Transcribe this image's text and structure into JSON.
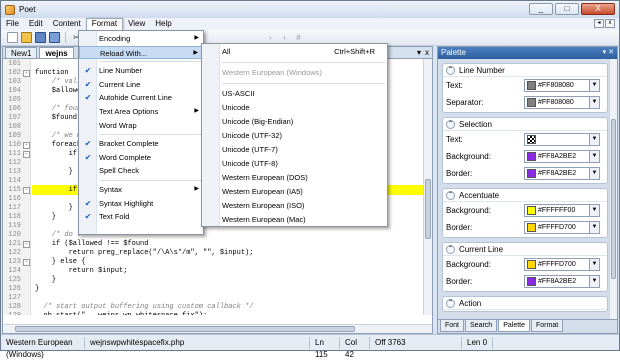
{
  "window": {
    "title": "Poet",
    "minimize_label": "_",
    "maximize_label": "□",
    "close_label": "X"
  },
  "menubar": {
    "items": [
      "File",
      "Edit",
      "Content",
      "Format",
      "View",
      "Help"
    ],
    "mdi_prev_label": "◂",
    "mdi_close_label": "x"
  },
  "editor": {
    "tabs": [
      "New1",
      "wejns"
    ],
    "tab_close_label": "x",
    "tab_menu_label": "▾",
    "lines": [
      {
        "n": "101",
        "fold": "",
        "text": ""
      },
      {
        "n": "102",
        "fold": "-",
        "text": "function "
      },
      {
        "n": "103",
        "fold": "",
        "text": "    /* vali"
      },
      {
        "n": "104",
        "fold": "",
        "text": "    $allowe"
      },
      {
        "n": "105",
        "fold": "",
        "text": ""
      },
      {
        "n": "106",
        "fold": "",
        "text": "    /* foun"
      },
      {
        "n": "107",
        "fold": "",
        "text": "    $found "
      },
      {
        "n": "108",
        "fold": "",
        "text": ""
      },
      {
        "n": "109",
        "fold": "",
        "text": "    /* we m"
      },
      {
        "n": "110",
        "fold": "-",
        "text": "    foreach"
      },
      {
        "n": "111",
        "fold": "-",
        "text": "        if "
      },
      {
        "n": "112",
        "fold": "",
        "text": "            "
      },
      {
        "n": "113",
        "fold": "",
        "text": "        }"
      },
      {
        "n": "114",
        "fold": "",
        "text": ""
      },
      {
        "n": "115",
        "fold": "-",
        "text": "        if "
      },
      {
        "n": "116",
        "fold": "",
        "text": ""
      },
      {
        "n": "117",
        "fold": "",
        "text": "        }"
      },
      {
        "n": "118",
        "fold": "",
        "text": "    }"
      },
      {
        "n": "119",
        "fold": "",
        "text": ""
      },
      {
        "n": "120",
        "fold": "",
        "text": "    /* do t"
      },
      {
        "n": "121",
        "fold": "-",
        "text": "    if ($allowed !== $found"
      },
      {
        "n": "122",
        "fold": "",
        "text": "        return preg_replace(\"/\\A\\s*/m\", \"\", $input);"
      },
      {
        "n": "123",
        "fold": "-",
        "text": "    } else {"
      },
      {
        "n": "124",
        "fold": "",
        "text": "        return $input;"
      },
      {
        "n": "125",
        "fold": "",
        "text": "    }"
      },
      {
        "n": "126",
        "fold": "",
        "text": "}"
      },
      {
        "n": "127",
        "fold": "",
        "text": ""
      },
      {
        "n": "128",
        "fold": "",
        "text": "  /* start output buffering using custom callback */"
      },
      {
        "n": "129",
        "fold": "",
        "text": "  ob_start(\"___wejns_wp_whitespace_fix\");"
      },
      {
        "n": "130",
        "fold": "",
        "text": ""
      }
    ],
    "right_fragment": "ml|xml))"
  },
  "format_menu": {
    "items": [
      {
        "label": "Encoding",
        "checked": false,
        "submenu": true
      },
      {
        "label": "Reload With...",
        "checked": false,
        "submenu": true,
        "hover": true
      },
      {
        "sep": true
      },
      {
        "label": "Line Number",
        "checked": true
      },
      {
        "label": "Current Line",
        "checked": true
      },
      {
        "label": "Autohide Current Line",
        "checked": true
      },
      {
        "label": "Text Area Options",
        "checked": false,
        "submenu": true
      },
      {
        "label": "Word Wrap",
        "checked": false
      },
      {
        "sep": true
      },
      {
        "label": "Bracket Complete",
        "checked": true
      },
      {
        "label": "Word Complete",
        "checked": true
      },
      {
        "label": "Spell Check",
        "checked": false
      },
      {
        "sep": true
      },
      {
        "label": "Syntax",
        "checked": false,
        "submenu": true
      },
      {
        "label": "Syntax Highlight",
        "checked": true
      },
      {
        "label": "Text Fold",
        "checked": true
      }
    ]
  },
  "reload_menu": {
    "items": [
      {
        "label": "All",
        "shortcut": "Ctrl+Shift+R"
      },
      {
        "sep": true
      },
      {
        "label": "Western European (Windows)",
        "disabled": true
      },
      {
        "sep": true
      },
      {
        "label": "US-ASCII"
      },
      {
        "label": "Unicode"
      },
      {
        "label": "Unicode (Big-Endian)"
      },
      {
        "label": "Unicode (UTF-32)"
      },
      {
        "label": "Unicode (UTF-7)"
      },
      {
        "label": "Unicode (UTF-8)"
      },
      {
        "label": "Western European (DOS)"
      },
      {
        "label": "Western European (IA5)"
      },
      {
        "label": "Western European (ISO)"
      },
      {
        "label": "Western European (Mac)"
      }
    ]
  },
  "palette": {
    "title": "Palette",
    "header_controls": "▾ ✕",
    "sections": [
      {
        "title": "Line Number",
        "rows": [
          {
            "label": "Text:",
            "value": "#FF808080",
            "color": "#808080"
          },
          {
            "label": "Separator:",
            "value": "#FF808080",
            "color": "#808080"
          }
        ]
      },
      {
        "title": "Selection",
        "rows": [
          {
            "label": "Text:",
            "value": "",
            "color": "checker"
          },
          {
            "label": "Background:",
            "value": "#FF8A2BE2",
            "color": "#8A2BE2"
          },
          {
            "label": "Border:",
            "value": "#FF8A2BE2",
            "color": "#8A2BE2"
          }
        ]
      },
      {
        "title": "Accentuate",
        "rows": [
          {
            "label": "Background:",
            "value": "#FFFFFF00",
            "color": "#FFFF00"
          },
          {
            "label": "Border:",
            "value": "#FFFFD700",
            "color": "#FFD700"
          }
        ]
      },
      {
        "title": "Current Line",
        "rows": [
          {
            "label": "Background:",
            "value": "#FFFFD700",
            "color": "#FFD700"
          },
          {
            "label": "Border:",
            "value": "#FF8A2BE2",
            "color": "#8A2BE2"
          }
        ]
      },
      {
        "title": "Action",
        "rows": []
      }
    ],
    "tabs": [
      "Font",
      "Search",
      "Palette",
      "Format"
    ],
    "selected_tab": "Palette"
  },
  "status": {
    "encoding": "Western European (Windows)",
    "file": "wejnswpwhitespacefix.php",
    "line": "Ln 115",
    "col": "Col 42",
    "offset": "Off 3763",
    "len": "Len 0"
  }
}
